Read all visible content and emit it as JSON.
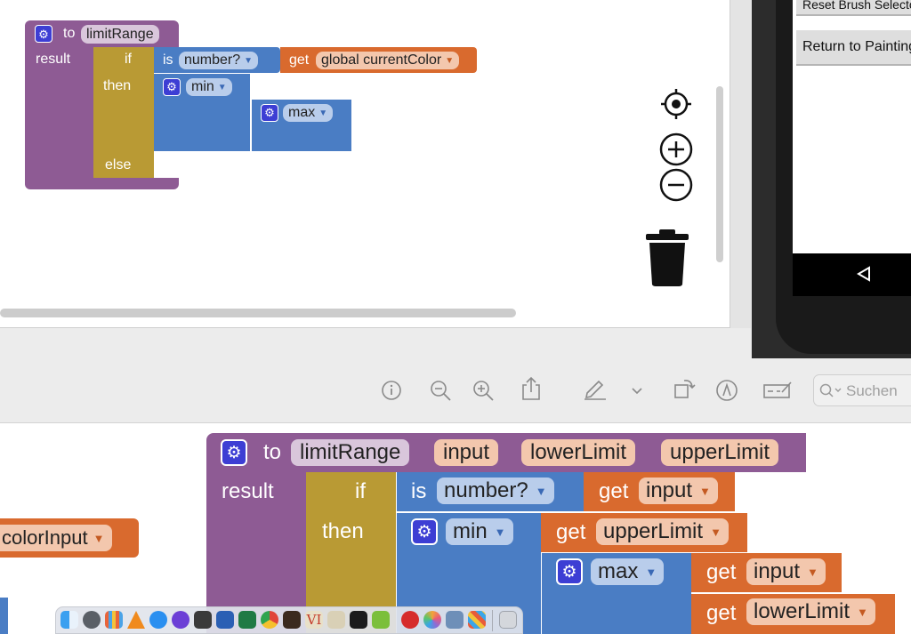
{
  "top_workspace": {
    "procedure": {
      "to_label": "to",
      "name": "limitRange",
      "result_label": "result"
    },
    "if_block": {
      "if_label": "if",
      "then_label": "then",
      "else_label": "else"
    },
    "is_label": "is",
    "number_check": "number?",
    "get_label": "get",
    "get_var": "global currentColor",
    "min_label": "min",
    "max_label": "max",
    "controls": {
      "recenter": "crosshair-icon",
      "zoom_in": "zoom-in-icon",
      "zoom_out": "zoom-out-icon",
      "trash": "trash-icon"
    }
  },
  "phone": {
    "button_reset": "Reset Brush Selecto",
    "button_return": "Return to Painting",
    "nav_back": "back-triangle-icon"
  },
  "preview_toolbar": {
    "search_placeholder": "Suchen",
    "icons": [
      "info-icon",
      "zoom-out-icon",
      "zoom-in-icon",
      "share-icon",
      "markup-pen-icon",
      "chevron-down-icon",
      "rotate-icon",
      "annotate-icon",
      "signature-icon"
    ]
  },
  "bottom_workspace": {
    "procedure": {
      "to_label": "to",
      "name": "limitRange",
      "params": [
        "input",
        "lowerLimit",
        "upperLimit"
      ],
      "result_label": "result"
    },
    "left_partial_var": "colorInput",
    "if_block": {
      "if_label": "if",
      "then_label": "then"
    },
    "is_label": "is",
    "number_check": "number?",
    "min_label": "min",
    "max_label": "max",
    "get_label": "get",
    "gets": [
      "input",
      "upperLimit",
      "input",
      "lowerLimit"
    ]
  },
  "dock": {
    "apps": [
      "finder-icon",
      "launchpad-icon",
      "grid-icon",
      "vlc-icon",
      "safari-icon",
      "imovie-icon",
      "calculator-icon",
      "word-icon",
      "excel-icon",
      "chrome-icon",
      "paint-icon",
      "vi-icon",
      "script-icon",
      "terminal-icon",
      "android-icon",
      "block-icon",
      "photos-icon",
      "preview-icon",
      "mosaic-icon",
      "trash-icon"
    ]
  },
  "colors": {
    "procedure_purple": "#8e5b94",
    "control_gold": "#b99a34",
    "math_blue": "#4a7dc4",
    "variable_orange": "#d96a2e",
    "gear_blue": "#3d3ed4"
  }
}
